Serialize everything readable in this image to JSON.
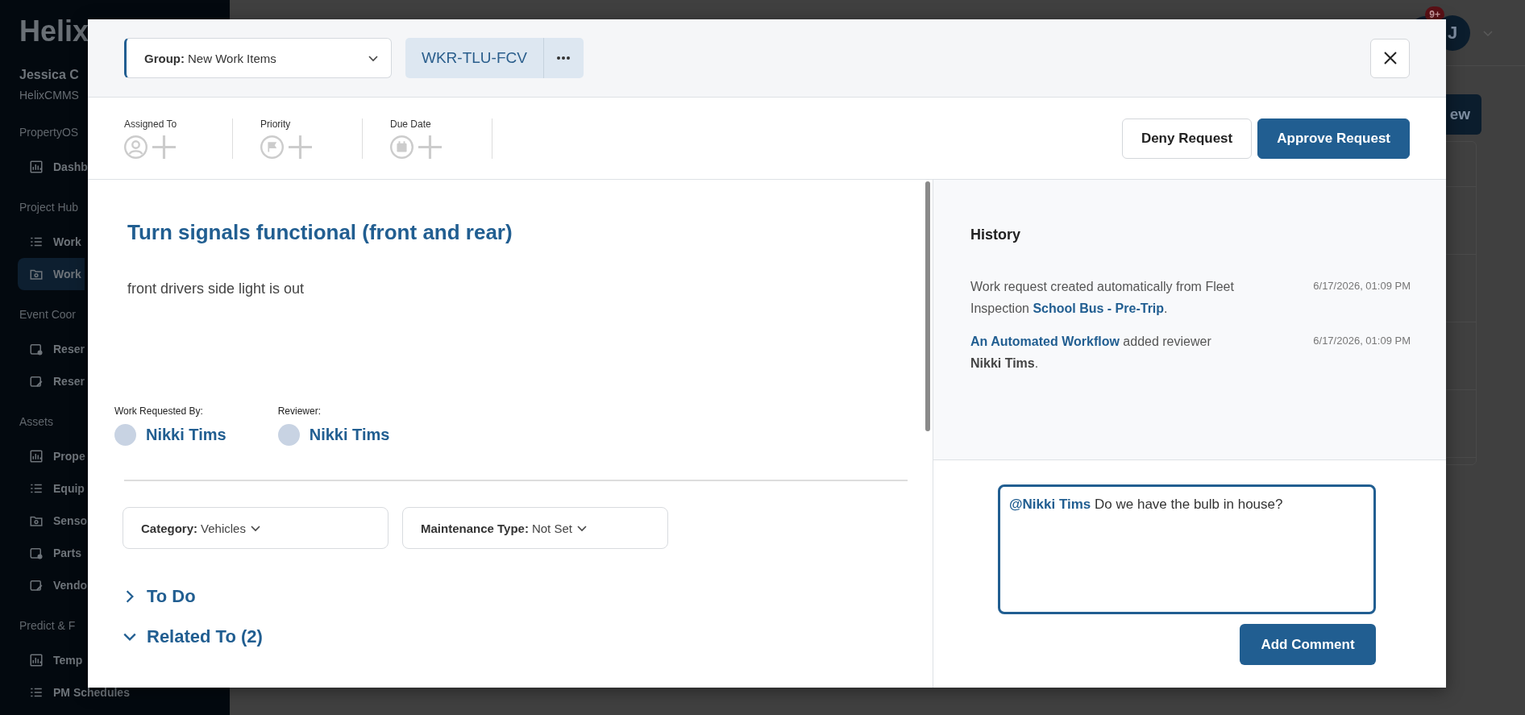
{
  "sidebar": {
    "logo": "Helix",
    "user_name": "Jessica C",
    "org": "HelixCMMS",
    "sections": [
      {
        "title": "PropertyOS",
        "items": [
          {
            "label": "Dashb",
            "selected": false
          }
        ]
      },
      {
        "title": "Project Hub",
        "items": [
          {
            "label": "Work",
            "selected": false
          },
          {
            "label": "Work",
            "selected": true
          }
        ]
      },
      {
        "title": "Event Coor",
        "items": [
          {
            "label": "Reser",
            "selected": false
          },
          {
            "label": "Reser",
            "selected": false
          }
        ]
      },
      {
        "title": "Assets",
        "items": [
          {
            "label": "Prope",
            "selected": false
          },
          {
            "label": "Equip",
            "selected": false
          },
          {
            "label": "Senso",
            "selected": false
          },
          {
            "label": "Parts",
            "selected": false
          },
          {
            "label": "Vendo",
            "selected": false
          }
        ]
      },
      {
        "title": "Predict & F",
        "items": [
          {
            "label": "Temp",
            "selected": false
          },
          {
            "label": "PM Schedules",
            "selected": false
          }
        ]
      }
    ]
  },
  "header": {
    "notification_badge": "9+",
    "avatar_initial": "J",
    "action_button": "ew"
  },
  "modal": {
    "group_select": {
      "label": "Group:",
      "value": "New Work Items"
    },
    "request_id": "WKR-TLU-FCV",
    "fields": [
      {
        "label": "Assigned To",
        "kind": "person"
      },
      {
        "label": "Priority",
        "kind": "flag"
      },
      {
        "label": "Due Date",
        "kind": "calendar"
      }
    ],
    "actions": [
      {
        "label": "Deny Request",
        "primary": false
      },
      {
        "label": "Approve Request",
        "primary": true
      }
    ],
    "title": "Turn signals functional (front and rear)",
    "description": "front drivers side light is out",
    "people": [
      {
        "label": "Work Requested By:",
        "name": "Nikki Tims"
      },
      {
        "label": "Reviewer:",
        "name": "Nikki Tims"
      }
    ],
    "selects": [
      {
        "label": "Category:",
        "value": "Vehicles"
      },
      {
        "label": "Maintenance Type:",
        "value": "Not Set"
      }
    ],
    "sections": [
      {
        "title": "To Do",
        "expanded": false
      },
      {
        "title": "Related To (2)",
        "expanded": true
      }
    ],
    "history": {
      "title": "History",
      "entries": [
        {
          "parts": [
            {
              "kind": "plain",
              "text": "Work request created automatically from Fleet Inspection "
            },
            {
              "kind": "link",
              "text": "School Bus - Pre-Trip"
            },
            {
              "kind": "plain",
              "text": "."
            }
          ],
          "time": "6/17/2026, 01:09 PM"
        },
        {
          "parts": [
            {
              "kind": "link",
              "text": "An Automated Workflow"
            },
            {
              "kind": "plain",
              "text": " added reviewer "
            },
            {
              "kind": "bold",
              "text": "Nikki Tims"
            },
            {
              "kind": "plain",
              "text": "."
            }
          ],
          "time": "6/17/2026, 01:09 PM"
        }
      ]
    },
    "comment": {
      "mention": "@Nikki Tims",
      "text": "Do we have the bulb in house?"
    },
    "add_comment_button": "Add Comment"
  }
}
